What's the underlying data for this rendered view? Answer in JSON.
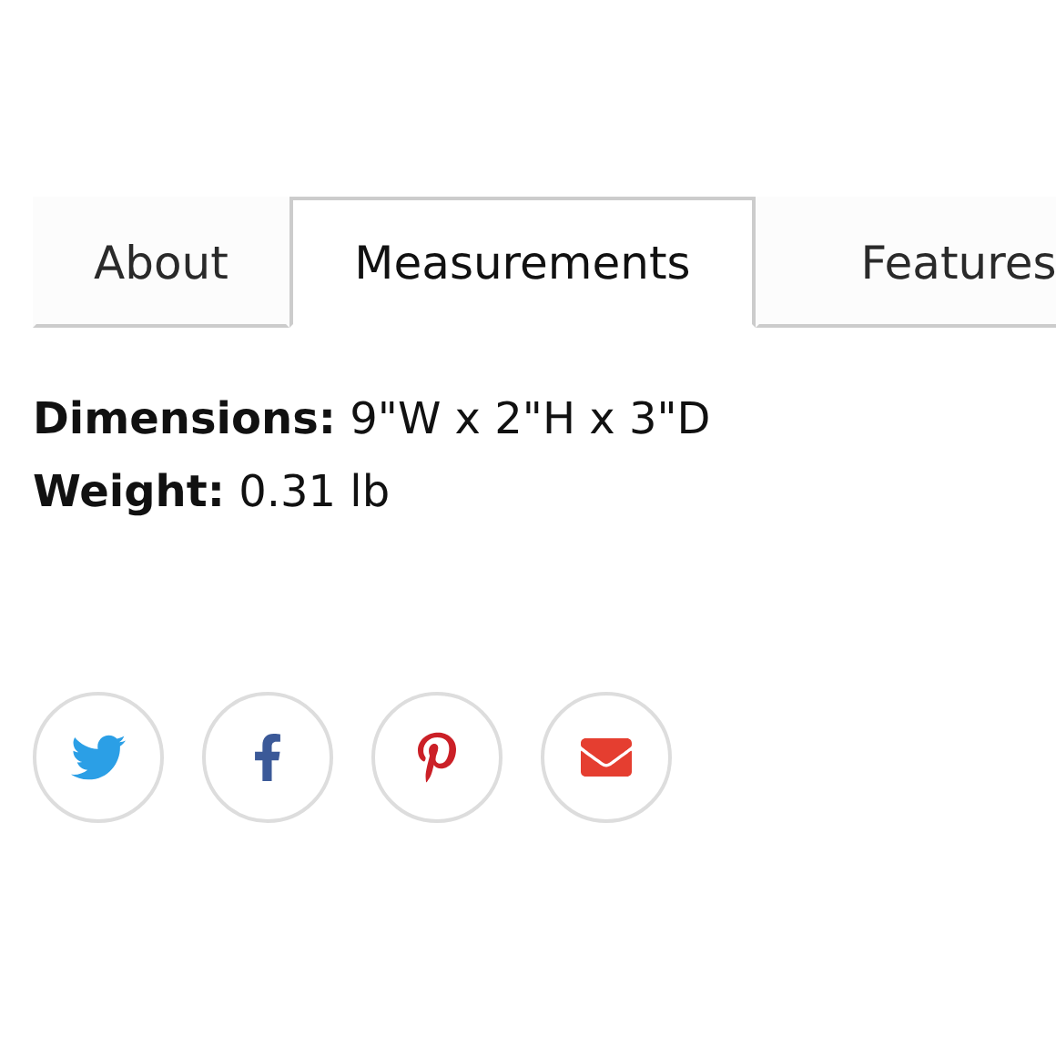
{
  "tabs": [
    {
      "label": "About",
      "selected": false
    },
    {
      "label": "Measurements",
      "selected": true
    },
    {
      "label": "Features",
      "selected": false
    }
  ],
  "specs": [
    "**Dimensions:** 9\"W x 2\"H x 3\"D",
    "**Weight:** 0.31 lb"
  ],
  "share": [
    {
      "kind": "twitter"
    },
    {
      "kind": "facebook"
    },
    {
      "kind": "pinterest"
    },
    {
      "kind": "email"
    }
  ]
}
